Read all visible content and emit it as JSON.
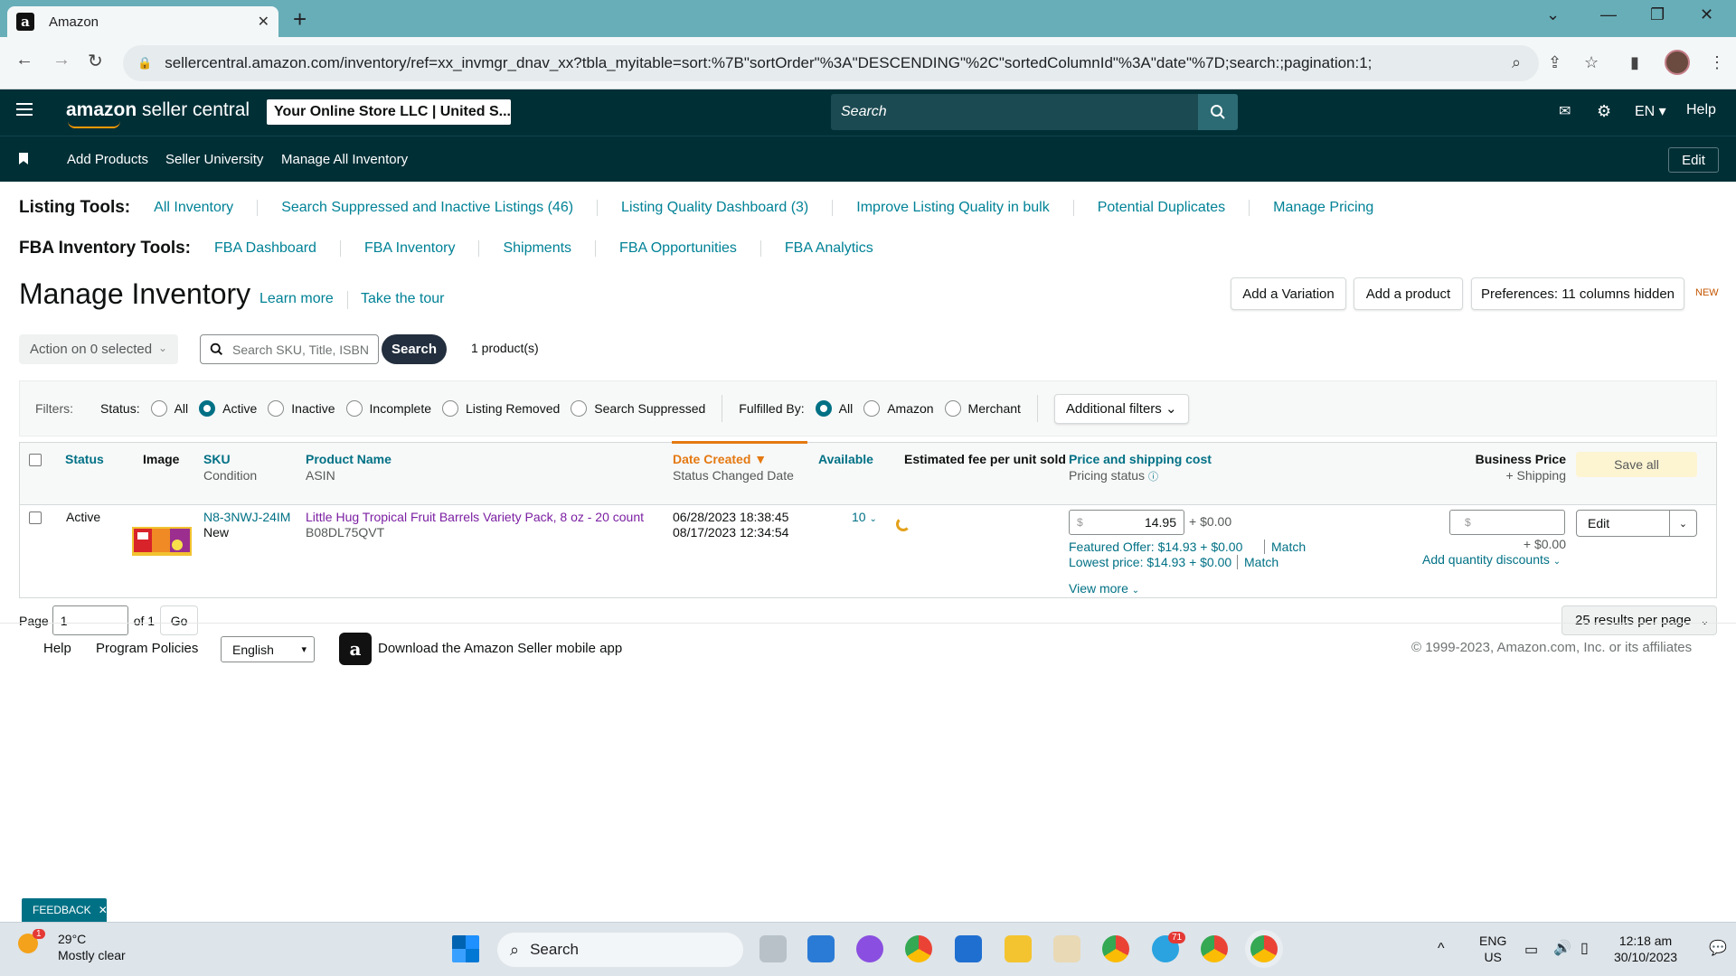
{
  "browser": {
    "tab_title": "Amazon",
    "url": "sellercentral.amazon.com/inventory/ref=xx_invmgr_dnav_xx?tbla_myitable=sort:%7B\"sortOrder\"%3A\"DESCENDING\"%2C\"sortedColumnId\"%3A\"date\"%7D;search:;pagination:1;"
  },
  "header": {
    "logo_bold": "amazon",
    "logo_rest": " seller central",
    "store": "Your Online Store LLC | United S...",
    "search_placeholder": "Search",
    "language": "EN",
    "help": "Help"
  },
  "bookmarks": {
    "items": [
      "Add Products",
      "Seller University",
      "Manage All Inventory"
    ],
    "edit": "Edit"
  },
  "listing_tools": {
    "heading": "Listing Tools:",
    "links": [
      "All Inventory",
      "Search Suppressed and Inactive Listings (46)",
      "Listing Quality Dashboard (3)",
      "Improve Listing Quality in bulk",
      "Potential Duplicates",
      "Manage Pricing"
    ]
  },
  "fba_tools": {
    "heading": "FBA Inventory Tools:",
    "links": [
      "FBA Dashboard",
      "FBA Inventory",
      "Shipments",
      "FBA Opportunities",
      "FBA Analytics"
    ]
  },
  "page": {
    "title": "Manage Inventory",
    "learn_more": "Learn more",
    "take_tour": "Take the tour",
    "add_variation": "Add a Variation",
    "add_product": "Add a product",
    "preferences": "Preferences: 11 columns hidden",
    "new_tag": "NEW",
    "action_select": "Action on 0 selected",
    "search_placeholder": "Search SKU, Title, ISBN",
    "search_button": "Search",
    "product_count": "1 product(s)"
  },
  "filters": {
    "label": "Filters:",
    "status_label": "Status:",
    "status_options": [
      "All",
      "Active",
      "Inactive",
      "Incomplete",
      "Listing Removed",
      "Search Suppressed"
    ],
    "status_selected": "Active",
    "fulfilled_label": "Fulfilled By:",
    "fulfilled_options": [
      "All",
      "Amazon",
      "Merchant"
    ],
    "fulfilled_selected": "All",
    "additional": "Additional filters"
  },
  "table": {
    "headers": {
      "status": "Status",
      "image": "Image",
      "sku": "SKU",
      "sku_sub": "Condition",
      "product": "Product Name",
      "product_sub": "ASIN",
      "date": "Date Created",
      "date_sub": "Status Changed Date",
      "available": "Available",
      "fee": "Estimated fee per unit sold",
      "price": "Price and shipping cost",
      "price_sub": "Pricing status",
      "business": "Business Price",
      "business_sub": "+ Shipping",
      "save_all": "Save all"
    },
    "rows": [
      {
        "status": "Active",
        "sku": "N8-3NWJ-24IM",
        "condition": "New",
        "product_name": "Little Hug Tropical Fruit Barrels Variety Pack, 8 oz - 20 count",
        "asin": "B08DL75QVT",
        "date_created": "06/28/2023 18:38:45",
        "status_changed": "08/17/2023 12:34:54",
        "available": "10",
        "price_currency": "$",
        "price": "14.95",
        "shipping": "+ $0.00",
        "featured_offer": "Featured Offer: $14.93 + $0.00",
        "lowest_price": "Lowest price: $14.93 + $0.00",
        "match": "Match",
        "view_more": "View more",
        "business_currency": "$",
        "business_shipping": "+ $0.00",
        "quantity_discounts": "Add quantity discounts",
        "edit": "Edit"
      }
    ]
  },
  "pagination": {
    "page_label": "Page",
    "page_value": "1",
    "of_label": "of 1",
    "go": "Go",
    "results_per_page": "25 results per page"
  },
  "footer": {
    "help": "Help",
    "policies": "Program Policies",
    "language": "English",
    "app": "Download the Amazon Seller mobile app",
    "copyright": "© 1999-2023, Amazon.com, Inc. or its affiliates"
  },
  "feedback": "FEEDBACK",
  "taskbar": {
    "weather_badge": "1",
    "temp": "29°C",
    "condition": "Mostly clear",
    "search": "Search",
    "telegram_badge": "71",
    "lang1": "ENG",
    "lang2": "US",
    "time": "12:18 am",
    "date": "30/10/2023"
  },
  "colors": {
    "header_bg": "#002f36",
    "link": "#008296",
    "sort_accent": "#e47911",
    "tab_strip": "#68aeb8"
  }
}
